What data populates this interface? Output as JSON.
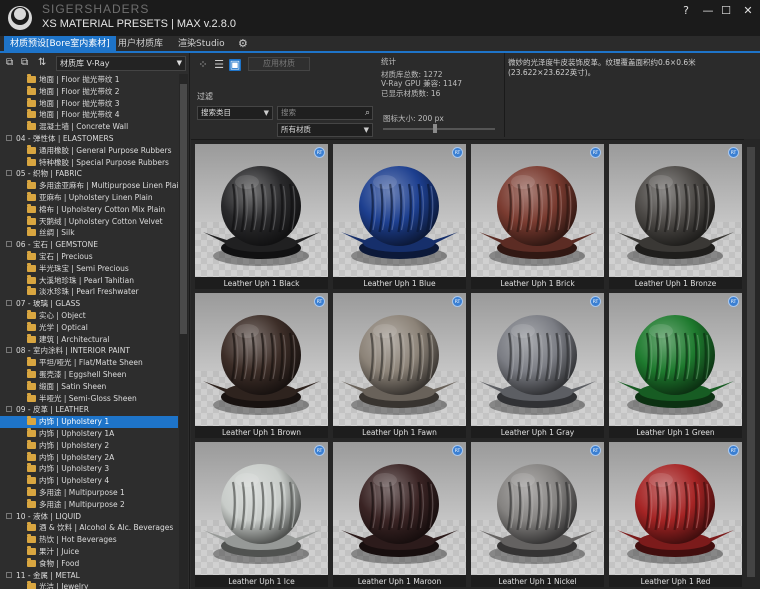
{
  "app": {
    "brand": "SIGERSHADERS",
    "title": "XS MATERIAL PRESETS | MAX v.2.8.0",
    "help_label": "?",
    "minimize_label": "—",
    "maximize_label": "☐",
    "close_label": "✕"
  },
  "tabs": [
    {
      "label": "材质预设[Bore室内素材]",
      "active": true
    },
    {
      "label": "用户材质库",
      "active": false
    },
    {
      "label": "渲染Studio",
      "active": false
    }
  ],
  "left": {
    "library_select": "材质库 V-Ray",
    "tree": [
      {
        "label": "地面 | Floor 抛光带纹 1",
        "type": "item"
      },
      {
        "label": "地面 | Floor 抛光带纹 2",
        "type": "item"
      },
      {
        "label": "地面 | Floor 抛光带纹 3",
        "type": "item"
      },
      {
        "label": "地面 | Floor 抛光带纹 4",
        "type": "item"
      },
      {
        "label": "混凝土墙 | Concrete Wall",
        "type": "item"
      },
      {
        "label": "04 - 弹性体 | ELASTOMERS",
        "type": "category"
      },
      {
        "label": "通用橡胶 | General Purpose Rubbers",
        "type": "item"
      },
      {
        "label": "特种橡胶 | Special Purpose Rubbers",
        "type": "item"
      },
      {
        "label": "05 - 织物 | FABRIC",
        "type": "category"
      },
      {
        "label": "多用途亚麻布 | Multipurpose Linen Plai",
        "type": "item"
      },
      {
        "label": "亚麻布 | Upholstery Linen Plain",
        "type": "item"
      },
      {
        "label": "棉布 | Upholstery Cotton Mix Plain",
        "type": "item"
      },
      {
        "label": "天鹅绒 | Upholstery Cotton Velvet",
        "type": "item"
      },
      {
        "label": "丝绸 | Silk",
        "type": "item"
      },
      {
        "label": "06 - 宝石 | GEMSTONE",
        "type": "category"
      },
      {
        "label": "宝石 | Precious",
        "type": "item"
      },
      {
        "label": "半光珠宝 | Semi Precious",
        "type": "item"
      },
      {
        "label": "大溪地珍珠 | Pearl Tahitian",
        "type": "item"
      },
      {
        "label": "淡水珍珠 | Pearl Freshwater",
        "type": "item"
      },
      {
        "label": "07 - 玻璃 | GLASS",
        "type": "category"
      },
      {
        "label": "实心 | Object",
        "type": "item"
      },
      {
        "label": "光学 | Optical",
        "type": "item"
      },
      {
        "label": "建筑 | Architectural",
        "type": "item"
      },
      {
        "label": "08 - 室内涂料 | INTERIOR PAINT",
        "type": "category"
      },
      {
        "label": "平坦/哑光 | Flat/Matte Sheen",
        "type": "item"
      },
      {
        "label": "蛋壳漆 | Eggshell Sheen",
        "type": "item"
      },
      {
        "label": "缎面 | Satin Sheen",
        "type": "item"
      },
      {
        "label": "半哑光 | Semi-Gloss Sheen",
        "type": "item"
      },
      {
        "label": "09 - 皮革 | LEATHER",
        "type": "category"
      },
      {
        "label": "内饰 | Upholstery 1",
        "type": "item",
        "selected": true
      },
      {
        "label": "内饰 | Upholstery 1A",
        "type": "item"
      },
      {
        "label": "内饰 | Upholstery 2",
        "type": "item"
      },
      {
        "label": "内饰 | Upholstery 2A",
        "type": "item"
      },
      {
        "label": "内饰 | Upholstery 3",
        "type": "item"
      },
      {
        "label": "内饰 | Upholstery 4",
        "type": "item"
      },
      {
        "label": "多用途 | Multipurpose 1",
        "type": "item"
      },
      {
        "label": "多用途 | Multipurpose 2",
        "type": "item"
      },
      {
        "label": "10 - 液体 | LIQUID",
        "type": "category"
      },
      {
        "label": "酒 & 饮料 | Alcohol & Alc. Beverages",
        "type": "item"
      },
      {
        "label": "热饮 | Hot Beverages",
        "type": "item"
      },
      {
        "label": "果汁 | Juice",
        "type": "item"
      },
      {
        "label": "食物 | Food",
        "type": "item"
      },
      {
        "label": "11 - 金属 | METAL",
        "type": "category"
      },
      {
        "label": "光洁 | Jewelry",
        "type": "item"
      }
    ]
  },
  "controls": {
    "assign_button": "应用材质",
    "filter_label": "过滤",
    "category_select": "搜索类目",
    "search_placeholder": "搜索",
    "material_select": "所有材质",
    "stats_title": "统计",
    "stats_total": "材质库总数: 1272",
    "stats_vray": "V-Ray GPU 兼容: 1147",
    "stats_shown": "已显示材质数: 16",
    "icon_size": "图标大小: 200 px",
    "icon_size_fraction": 0.46,
    "description": "微妙的光泽度牛皮装饰皮革。纹理覆盖面积约0.6×0.6米(23.622×23.622英寸)。"
  },
  "materials": [
    {
      "name": "Leather Uph 1 Black",
      "color": "#2a2a2c",
      "badge": "RT"
    },
    {
      "name": "Leather Uph 1 Blue",
      "color": "#1d3f8f",
      "badge": "RT"
    },
    {
      "name": "Leather Uph 1 Brick",
      "color": "#7a3b30",
      "badge": "RT"
    },
    {
      "name": "Leather Uph 1 Bronze",
      "color": "#4d4a47",
      "badge": "RT"
    },
    {
      "name": "Leather Uph 1 Brown",
      "color": "#3d2e28",
      "badge": "RT"
    },
    {
      "name": "Leather Uph 1 Fawn",
      "color": "#8c8378",
      "badge": "RT"
    },
    {
      "name": "Leather Uph 1 Gray",
      "color": "#7b7d84",
      "badge": "RT"
    },
    {
      "name": "Leather Uph 1 Green",
      "color": "#1e7a2e",
      "badge": "RT"
    },
    {
      "name": "Leather Uph 1 Ice",
      "color": "#c8ccc9",
      "badge": "RT"
    },
    {
      "name": "Leather Uph 1 Maroon",
      "color": "#3a2424",
      "badge": "RT"
    },
    {
      "name": "Leather Uph 1 Nickel",
      "color": "#858381",
      "badge": "RT"
    },
    {
      "name": "Leather Uph 1 Red",
      "color": "#a52424",
      "badge": "RT"
    }
  ],
  "colors": {
    "accent": "#1e74c9",
    "folder": "#d9a640"
  }
}
